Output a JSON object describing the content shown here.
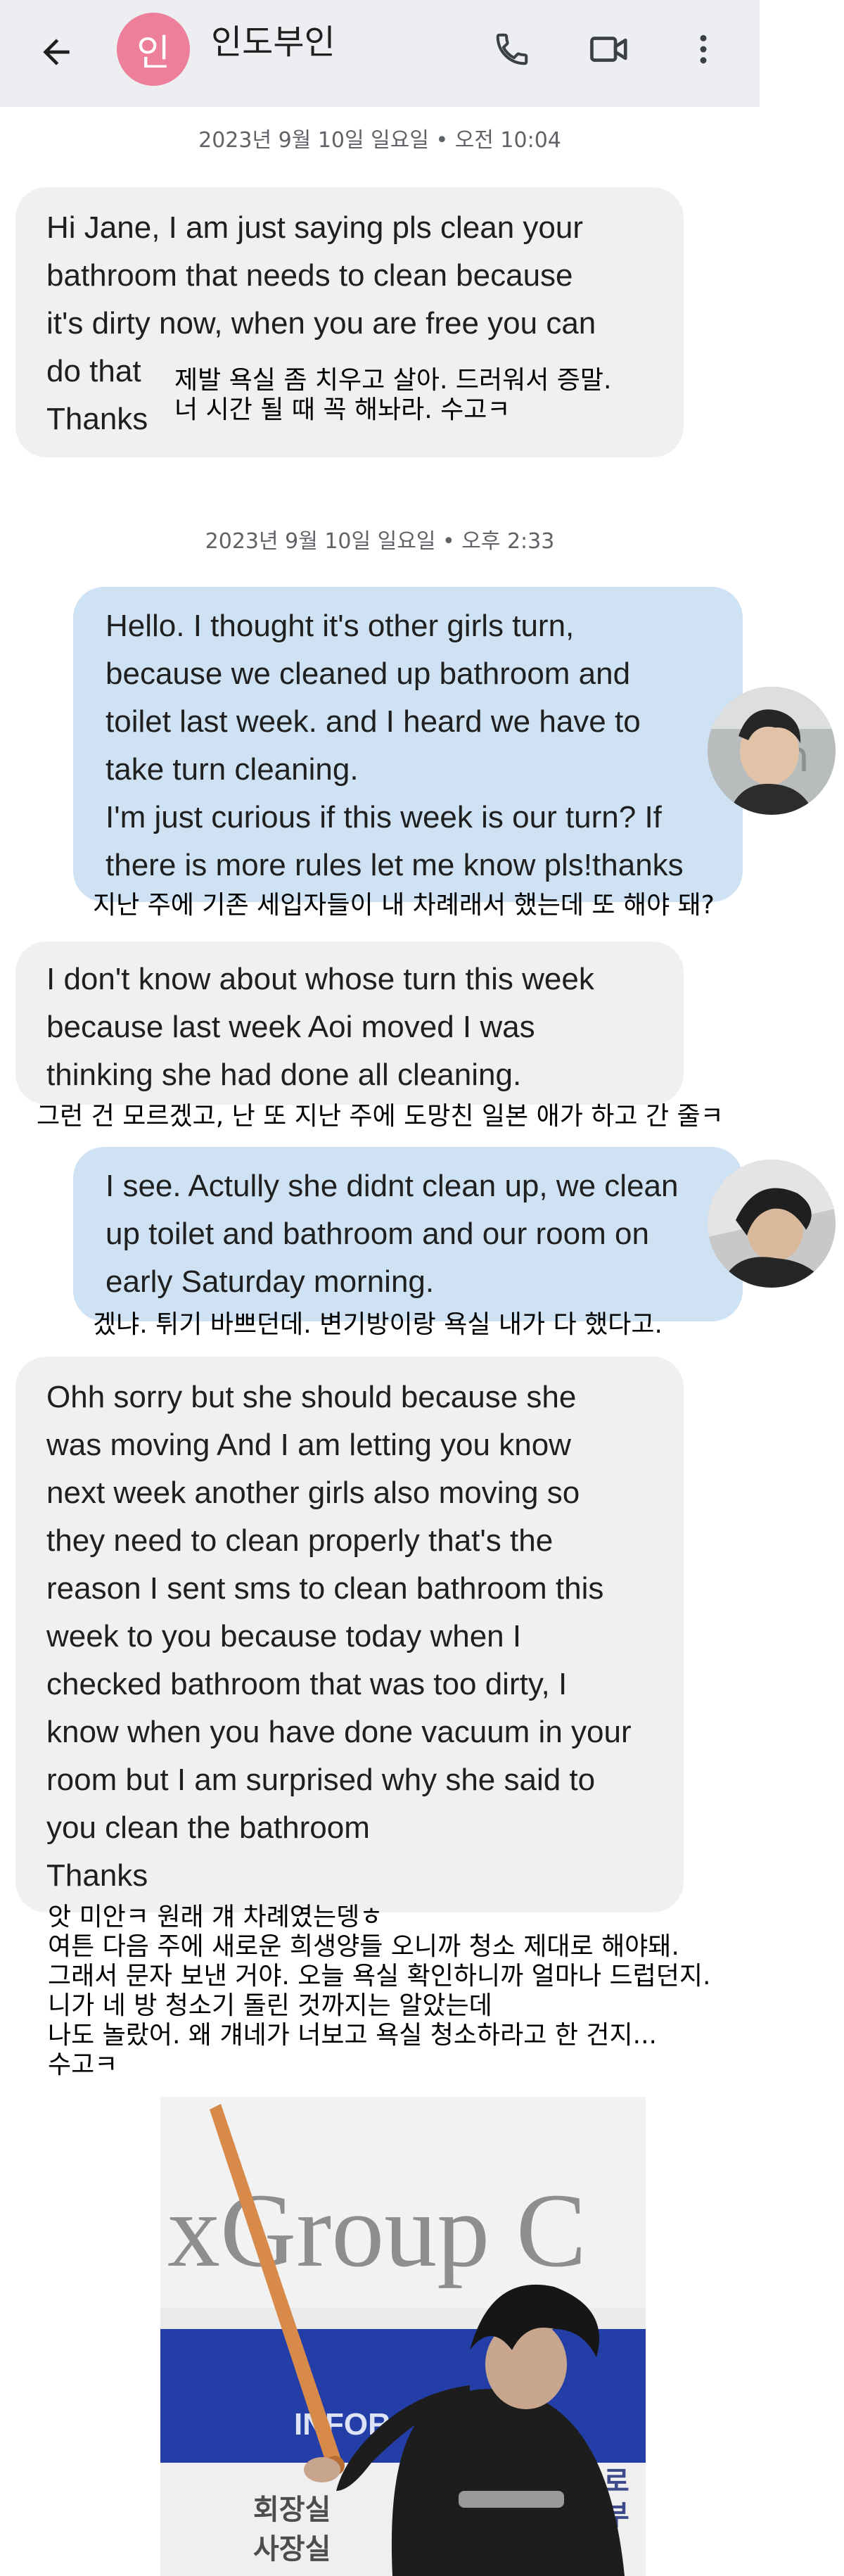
{
  "header": {
    "contact_initial": "인",
    "contact_name": "인도부인"
  },
  "icons": {
    "back": "arrow-back-icon",
    "call": "phone-icon",
    "video": "video-call-icon",
    "more": "more-vert-icon"
  },
  "colors": {
    "header_bg": "#eceef1",
    "avatar_bg": "#ee7f9b",
    "incoming_bubble": "#f0f0f2",
    "outgoing_bubble": "#cfe2f3"
  },
  "dates": [
    "2023년 9월 10일 일요일 • 오전 10:04",
    "2023년 9월 10일 일요일 • 오후 2:33"
  ],
  "messages": [
    {
      "direction": "incoming",
      "text": "Hi Jane, I am just saying pls clean your\nbathroom that needs to clean because\nit's dirty now, when you are free you can\ndo that\nThanks"
    },
    {
      "direction": "outgoing",
      "text": "Hello. I thought it's other girls turn,\nbecause we cleaned up bathroom and\ntoilet last week. and I heard we have to\ntake turn cleaning.\n I'm just curious if this week is our turn? If\nthere is more rules let me know pls!thanks"
    },
    {
      "direction": "incoming",
      "text": "I don't know about whose turn this week\nbecause last week Aoi moved I was\nthinking she had  done all cleaning."
    },
    {
      "direction": "outgoing",
      "text": "I see. Actully she didnt clean up, we clean\nup toilet and bathroom and our room on\nearly Saturday morning."
    },
    {
      "direction": "incoming",
      "text": "Ohh sorry but she should because she\nwas moving And I am letting you know\nnext week another girls also moving so\nthey need to clean properly that's the\nreason I sent sms to clean bathroom this\nweek to you because today when I\nchecked bathroom that was too dirty, I\nknow when you have done vacuum in your\nroom but I am surprised why she said to\nyou clean the bathroom\nThanks"
    }
  ],
  "captions": [
    "제발 욕실 좀 치우고 살아. 드러워서 증말.\n너 시간 될 때 꼭 해놔라. 수고ㅋ",
    "지난 주에 기존 세입자들이 내 차례래서 했는데 또 해야 돼?",
    "그런 건 모르겠고, 난 또 지난 주에 도망친 일본 애가 하고 간 줄ㅋ",
    "겠냐. 튀기 바쁘던데. 변기방이랑 욕실 내가 다 했다고.",
    "앗 미안ㅋ 원래 걔 차례였는뎅ㅎ\n여튼 다음 주에 새로운 희생양들 오니까 청소 제대로 해야돼.\n그래서 문자 보낸 거야. 오늘 욕실 확인하니까 얼마나 드럽던지.\n니가 네 방 청소기 돌린 것까지는 알았는데\n나도 놀랐어. 왜 걔네가 너보고 욕실 청소하라고 한 건지...\n수고ㅋ"
  ],
  "image": {
    "sign_text": "xGroup C",
    "banner_text": "INFOR",
    "door_label_1": "회장실",
    "door_label_2": "사장실",
    "side_label": "로\n부"
  }
}
